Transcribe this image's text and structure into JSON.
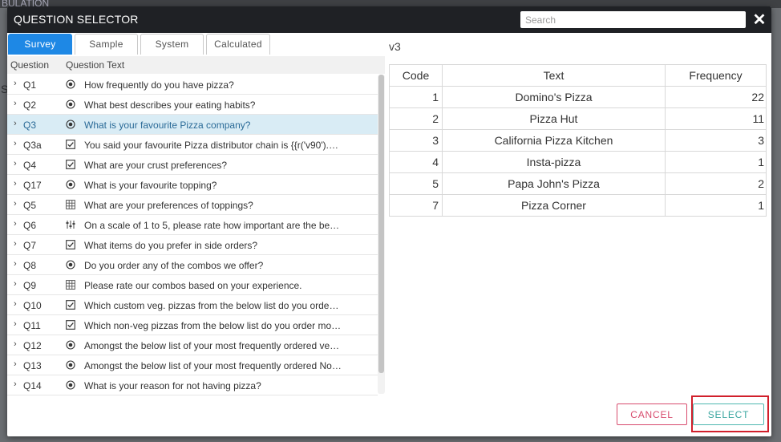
{
  "background": {
    "strip_text": "BULATION",
    "side_letter": "S"
  },
  "dialog": {
    "title": "QUESTION SELECTOR",
    "search_placeholder": "Search",
    "close_glyph": "✕"
  },
  "tabs": [
    {
      "label": "Survey",
      "active": true
    },
    {
      "label": "Sample",
      "active": false
    },
    {
      "label": "System",
      "active": false
    },
    {
      "label": "Calculated",
      "active": false
    }
  ],
  "question_list": {
    "headers": {
      "code": "Question",
      "text": "Question Text"
    },
    "rows": [
      {
        "code": "Q1",
        "icon": "radio-icon",
        "text": "How frequently do you have pizza?"
      },
      {
        "code": "Q2",
        "icon": "radio-icon",
        "text": "What best describes your eating habits?"
      },
      {
        "code": "Q3",
        "icon": "radio-icon",
        "text": "What is your favourite Pizza company?",
        "selected": true
      },
      {
        "code": "Q3a",
        "icon": "checkbox-icon",
        "text": "You said your favourite Pizza distributor chain is {{r('v90').…"
      },
      {
        "code": "Q4",
        "icon": "checkbox-icon",
        "text": "What are your crust preferences?"
      },
      {
        "code": "Q17",
        "icon": "radio-icon",
        "text": "What is your favourite topping?"
      },
      {
        "code": "Q5",
        "icon": "grid-icon",
        "text": "What are your preferences of toppings?"
      },
      {
        "code": "Q6",
        "icon": "slider-icon",
        "text": "On a scale of 1 to 5, please rate how important are the be…"
      },
      {
        "code": "Q7",
        "icon": "checkbox-icon",
        "text": "What items do you prefer in side orders?"
      },
      {
        "code": "Q8",
        "icon": "radio-icon",
        "text": "Do you order any of the combos we offer?"
      },
      {
        "code": "Q9",
        "icon": "grid-icon",
        "text": "Please rate our combos based on your experience."
      },
      {
        "code": "Q10",
        "icon": "checkbox-icon",
        "text": "Which custom veg. pizzas from the below list do you orde…"
      },
      {
        "code": "Q11",
        "icon": "checkbox-icon",
        "text": "Which non-veg pizzas from the below list do you order mo…"
      },
      {
        "code": "Q12",
        "icon": "radio-icon",
        "text": "Amongst the below list of your most frequently ordered ve…"
      },
      {
        "code": "Q13",
        "icon": "radio-icon",
        "text": "Amongst the below list of your most frequently ordered No…"
      },
      {
        "code": "Q14",
        "icon": "radio-icon",
        "text": "What is your reason for not having pizza?"
      }
    ]
  },
  "detail": {
    "variable": "v3",
    "table": {
      "headers": {
        "code": "Code",
        "text": "Text",
        "frequency": "Frequency"
      },
      "rows": [
        {
          "code": "1",
          "text": "Domino's Pizza",
          "frequency": "22"
        },
        {
          "code": "2",
          "text": "Pizza Hut",
          "frequency": "11"
        },
        {
          "code": "3",
          "text": "California Pizza Kitchen",
          "frequency": "3"
        },
        {
          "code": "4",
          "text": "Insta-pizza",
          "frequency": "1"
        },
        {
          "code": "5",
          "text": "Papa John's Pizza",
          "frequency": "2"
        },
        {
          "code": "7",
          "text": "Pizza Corner",
          "frequency": "1"
        }
      ]
    }
  },
  "buttons": {
    "cancel": "CANCEL",
    "select": "SELECT"
  },
  "colors": {
    "header_bg": "#1f2125",
    "active_tab": "#1e88e5",
    "selected_row": "#d9ecf5",
    "cancel": "#d84c6e",
    "select": "#3aa6a0",
    "highlight_box": "#d11f2b"
  }
}
